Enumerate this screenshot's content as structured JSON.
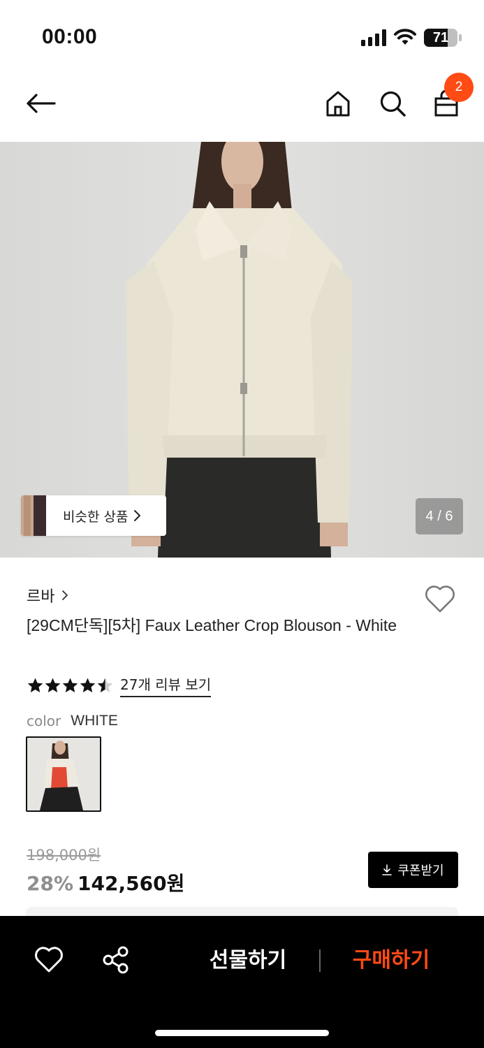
{
  "status_bar": {
    "time": "00:00",
    "battery_percent": 71,
    "battery_text": "71"
  },
  "nav": {
    "back_icon": "arrow-left-icon",
    "home_icon": "home-icon",
    "search_icon": "search-icon",
    "bag_icon": "shopping-bag-icon",
    "cart_count": "2"
  },
  "hero": {
    "similar_products_label": "비슷한 상품",
    "page_indicator": "4 / 6",
    "current_image": 4,
    "total_images": 6
  },
  "product": {
    "brand": "르바",
    "title": "[29CM단독][5차] Faux Leather Crop Blouson - White",
    "rating": 4.5,
    "review_link": "27개 리뷰 보기",
    "color_label": "color",
    "color_value": "WHITE",
    "original_price": "198,000원",
    "discount": "28%",
    "sale_price": "142,560원",
    "coupon_label": "쿠폰받기"
  },
  "bottom_bar": {
    "like_icon": "heart-icon",
    "share_icon": "share-icon",
    "gift_label": "선물하기",
    "buy_label": "구매하기"
  },
  "colors": {
    "accent": "#ff4b14",
    "black": "#000000",
    "muted": "#8f8f8f"
  }
}
